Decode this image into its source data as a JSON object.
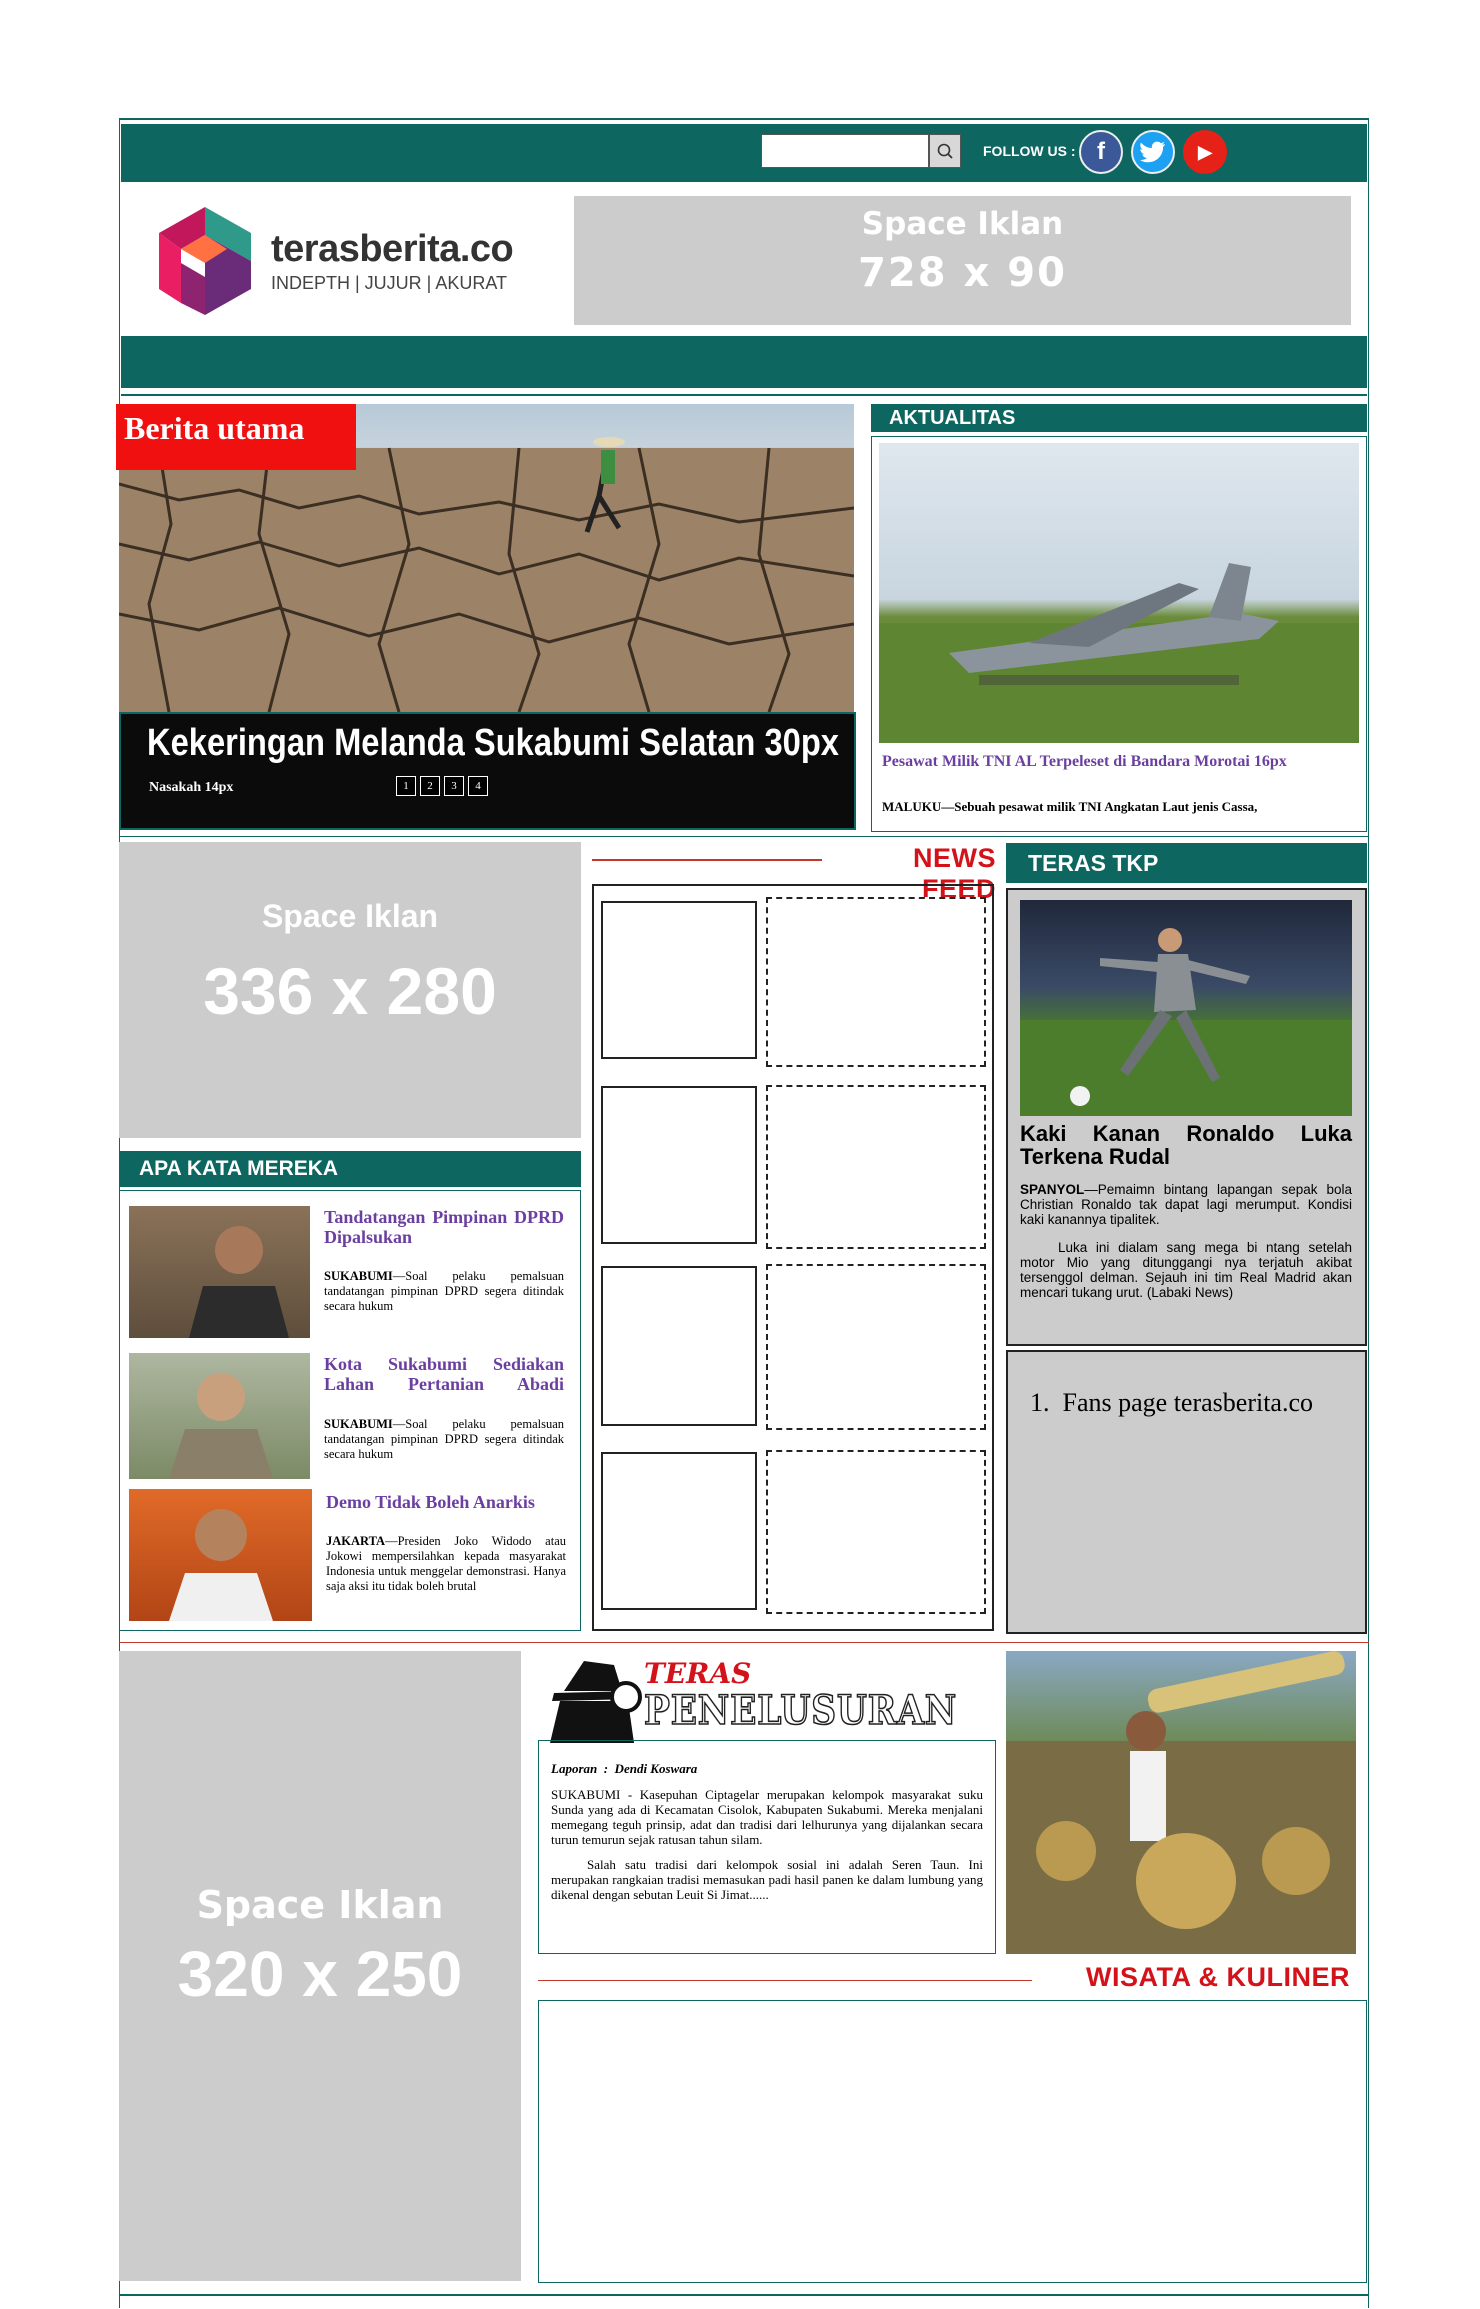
{
  "header": {
    "search": {
      "value": "",
      "placeholder": ""
    },
    "follow_label": "FOLLOW US :",
    "social": [
      {
        "name": "facebook",
        "glyph": "f",
        "color": "#3b5998"
      },
      {
        "name": "twitter",
        "glyph": "t",
        "color": "#1da1f2"
      },
      {
        "name": "youtube",
        "glyph": "▶",
        "color": "#e62117"
      }
    ],
    "logo": {
      "name": "terasberita.co",
      "tagline": "INDEPTH | JUJUR | AKURAT"
    },
    "ad_top": {
      "title": "Space Iklan",
      "size": "728 x 90"
    }
  },
  "headline": {
    "badge": "Berita utama",
    "title": "Kekeringan Melanda Sukabumi Selatan 30px",
    "subtitle": "Nasakah 14px",
    "pages": [
      "1",
      "2",
      "3",
      "4"
    ]
  },
  "aktualitas": {
    "heading": "AKTUALITAS",
    "title": "Pesawat Milik TNI AL Terpeleset di Bandara Morotai 16px",
    "excerpt_lead": "MALUKU",
    "excerpt": "—Sebuah pesawat milik TNI Angkatan Laut jenis Cassa,"
  },
  "ad_mid": {
    "title": "Space Iklan",
    "size": "336 x 280"
  },
  "newsfeed": {
    "heading": "NEWS FEED"
  },
  "apa_kata": {
    "heading": "APA KATA MEREKA",
    "items": [
      {
        "title": "Tandatangan Pimpinan DPRD Dipalsukan",
        "lead": "SUKABUMI",
        "text": "—Soal pelaku pemalsuan tandatangan pimpinan DPRD segera ditindak secara hukum"
      },
      {
        "title": "Kota Sukabumi Sediakan Lahan Pertanian Abadi",
        "lead": "SUKABUMI",
        "text": "—Soal pelaku pemalsuan tandatangan pimpinan DPRD segera ditindak secara hukum"
      },
      {
        "title": "Demo Tidak Boleh Anarkis",
        "lead": "JAKARTA",
        "text": "—Presiden Joko Widodo atau Jokowi mempersilahkan kepada masyarakat Indonesia untuk menggelar demonstrasi. Hanya saja aksi itu tidak boleh brutal"
      }
    ]
  },
  "teras_tkp": {
    "heading": "TERAS TKP",
    "title": "Kaki Kanan Ronaldo Luka Terkena Rudal",
    "p1_lead": "SPANYOL",
    "p1": "—Pemaimn bintang lapangan sepak bola Christian Ronaldo tak dapat lagi merumput. Kondisi kaki kanannya tipalitek.",
    "p2": "Luka ini dialam sang mega bi ntang setelah motor Mio yang ditunggangi nya terjatuh akibat tersenggol delman. Sejauh ini tim Real Madrid akan mencari tukang urut. (Labaki News)",
    "fanspage": "1.  Fans page terasberita.co"
  },
  "ad_bottom": {
    "title": "Space Iklan",
    "size": "320 x 250"
  },
  "penelusuran": {
    "logo_top": "TERAS",
    "logo_bottom": "PENELUSURAN",
    "byline": "Laporan  :  Dendi Koswara",
    "p1": "SUKABUMI - Kasepuhan Ciptagelar merupakan kelompok masyarakat suku Sunda yang ada di Kecamatan Cisolok, Kabupaten Sukabumi. Mereka menjalani memegang teguh prinsip, adat dan tradisi dari lelhurunya yang dijalankan secara turun temurun sejak ratusan tahun silam.",
    "p2": "Salah satu tradisi dari kelompok sosial ini adalah Seren Taun. Ini merupakan rangkaian tradisi memasukan padi hasil panen ke dalam lumbung yang dikenal dengan sebutan Leuit Si Jimat......"
  },
  "wisata": {
    "heading": "WISATA & KULINER"
  }
}
